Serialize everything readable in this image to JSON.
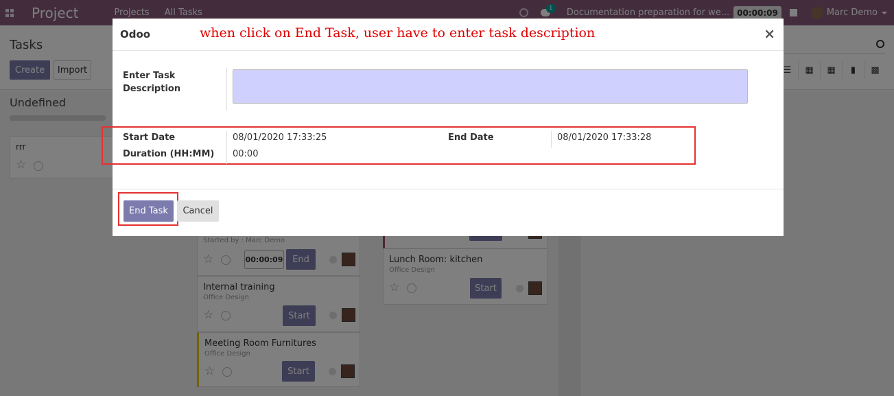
{
  "navbar": {
    "brand": "Project",
    "menus": [
      "Projects",
      "All Tasks"
    ],
    "chat_count": "1",
    "current_task": "Documentation preparation for we...",
    "timer": "00:00:09",
    "user": "Marc Demo"
  },
  "control_panel": {
    "title": "Tasks",
    "create_label": "Create",
    "import_label": "Import"
  },
  "kanban": {
    "column_title": "Undefined",
    "cards": [
      {
        "title": "rrr"
      },
      {
        "started_by": "Started by : Marc Demo",
        "timer": "00:00:09",
        "button": "End"
      },
      {
        "title": "Internal training",
        "project": "Office Design",
        "button": "Start"
      },
      {
        "title": "Meeting Room Furnitures",
        "project": "Office Design",
        "button": "Start"
      },
      {
        "title": "Lunch Room: kitchen",
        "project": "Office Design",
        "button": "Start"
      }
    ]
  },
  "modal": {
    "title": "Odoo",
    "annotation": "when click on End Task, user have to enter task description",
    "description_label": "Enter Task Description",
    "start_date_label": "Start Date",
    "start_date_value": "08/01/2020 17:33:25",
    "end_date_label": "End Date",
    "end_date_value": "08/01/2020 17:33:28",
    "duration_label": "Duration (HH:MM)",
    "duration_value": "00:00",
    "end_task_label": "End Task",
    "cancel_label": "Cancel"
  },
  "colors": {
    "navbar": "#875a7b",
    "primary": "#7c7bad",
    "annotation": "#e00000",
    "highlight_box": "#e53030",
    "description_fill": "#d0d0ff"
  }
}
